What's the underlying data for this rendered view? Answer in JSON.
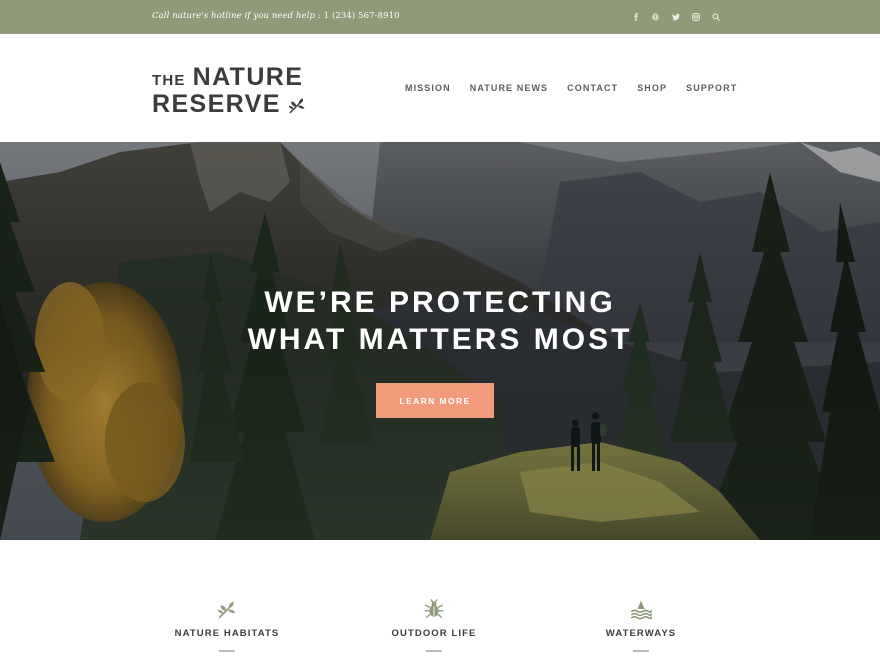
{
  "topbar": {
    "hotline_text": "Call nature's hotline if you need help : ",
    "hotline_number": "1 (234) 567-8910",
    "social_icons": [
      "facebook-icon",
      "pinterest-icon",
      "twitter-icon",
      "instagram-icon",
      "search-icon"
    ]
  },
  "logo": {
    "the": "THE",
    "nature": "NATURE",
    "reserve": "RESERVE"
  },
  "nav": {
    "items": [
      {
        "label": "MISSION"
      },
      {
        "label": "NATURE NEWS"
      },
      {
        "label": "CONTACT"
      },
      {
        "label": "SHOP"
      },
      {
        "label": "SUPPORT"
      }
    ]
  },
  "hero": {
    "title_line1": "WE’RE PROTECTING",
    "title_line2": "WHAT MATTERS MOST",
    "cta_label": "LEARN MORE"
  },
  "features": [
    {
      "label": "NATURE HABITATS",
      "icon": "leaf-icon"
    },
    {
      "label": "OUTDOOR LIFE",
      "icon": "bug-icon"
    },
    {
      "label": "WATERWAYS",
      "icon": "waves-icon"
    }
  ],
  "colors": {
    "topbar": "#8e9a79",
    "accent_button": "#f19a7c",
    "icon_green": "#8e9a79",
    "text_dark": "#3a3d3b"
  }
}
